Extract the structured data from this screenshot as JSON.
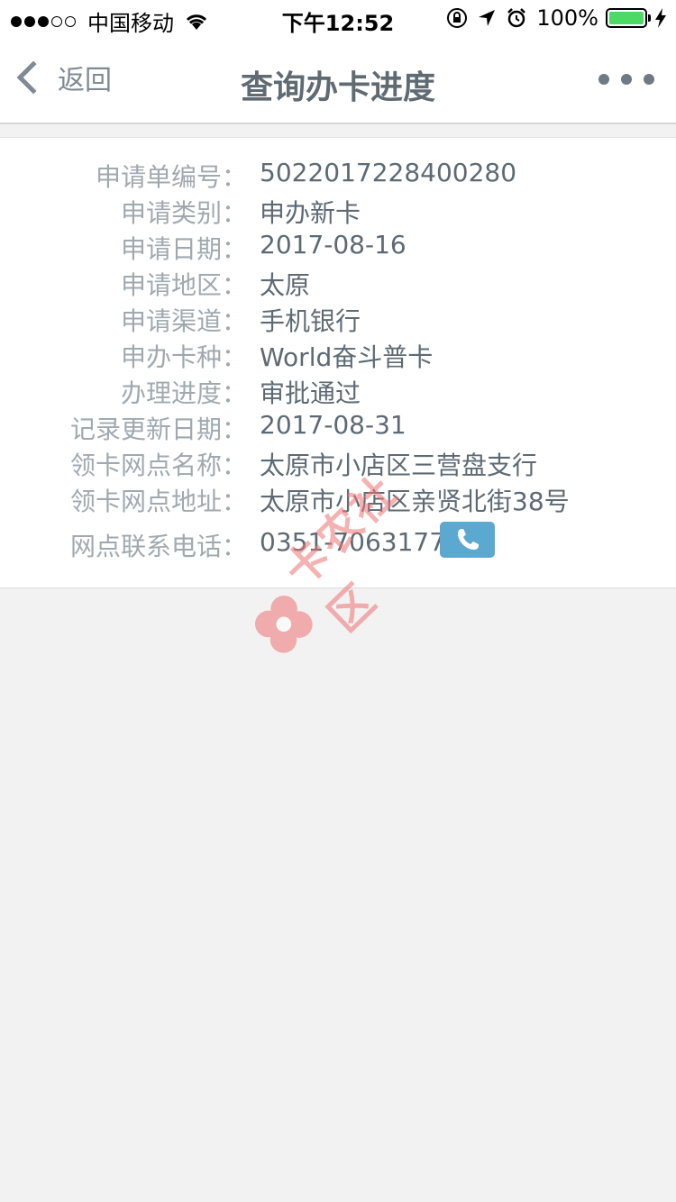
{
  "status_bar": {
    "carrier": "中国移动",
    "time": "下午12:52",
    "battery": "100%",
    "icons": [
      "wifi-icon",
      "rotation-lock-icon",
      "location-icon",
      "alarm-icon",
      "charging-bolt-icon"
    ]
  },
  "nav": {
    "back_label": "返回",
    "title": "查询办卡进度",
    "more_icon": "more-dots-icon"
  },
  "fields": [
    {
      "label": "申请单编号：",
      "value": "5022017228400280"
    },
    {
      "label": "申请类别：",
      "value": "申办新卡"
    },
    {
      "label": "申请日期：",
      "value": "2017-08-16"
    },
    {
      "label": "申请地区：",
      "value": "太原"
    },
    {
      "label": "申请渠道：",
      "value": "手机银行"
    },
    {
      "label": "申办卡种：",
      "value": "World奋斗普卡"
    },
    {
      "label": "办理进度：",
      "value": "审批通过"
    },
    {
      "label": "记录更新日期：",
      "value": "2017-08-31"
    },
    {
      "label": "领卡网点名称：",
      "value": "太原市小店区三营盘支行"
    },
    {
      "label": "领卡网点地址：",
      "value": "太原市小店区亲贤北街38号"
    },
    {
      "label": "网点联系电话：",
      "value": "0351-7063177"
    }
  ],
  "phone_icon": "phone-icon",
  "watermark": {
    "text": "卡农社区",
    "color": "#f07373"
  },
  "colors": {
    "accent": "#5ba8d0",
    "label": "#a0a9b0",
    "value": "#5d6a74",
    "battery": "#4cd964"
  }
}
